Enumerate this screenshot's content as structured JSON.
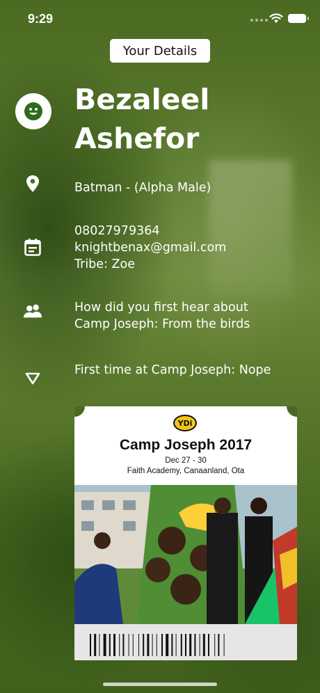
{
  "status_bar": {
    "time": "9:29"
  },
  "header": {
    "title": "Your Details"
  },
  "profile": {
    "first_name": "Bezaleel",
    "last_name": "Ashefor"
  },
  "details": {
    "role": "Batman - (Alpha Male)",
    "phone": "08027979364",
    "email": "knightbenax@gmail.com",
    "tribe": "Tribe: Zoe",
    "referral_line1": "How did you first hear about",
    "referral_line2": "Camp Joseph: From the birds",
    "first_time": "First time at Camp Joseph: Nope"
  },
  "ticket": {
    "logo_text": "YDi",
    "title": "Camp Joseph 2017",
    "dates": "Dec 27 - 30",
    "venue": "Faith Academy, Canaanland, Ota"
  },
  "icons": {
    "avatar": "smiley-face-icon",
    "location": "location-pin-icon",
    "contact": "calendar-icon",
    "referral": "people-icon",
    "first_time": "triangle-down-icon"
  },
  "colors": {
    "accent_green": "#2e6b1c",
    "text": "#ffffff"
  }
}
